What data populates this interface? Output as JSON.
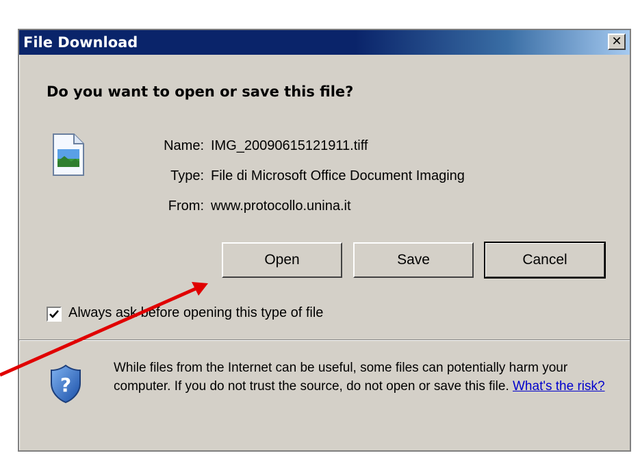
{
  "dialog": {
    "title": "File Download",
    "close_glyph": "✕",
    "question": "Do you want to open or save this file?",
    "file": {
      "icon": "image-file-icon",
      "name_label": "Name:",
      "name_value": "IMG_20090615121911.tiff",
      "type_label": "Type:",
      "type_value": "File di Microsoft Office Document Imaging",
      "from_label": "From:",
      "from_value": "www.protocollo.unina.it"
    },
    "buttons": {
      "open": "Open",
      "save": "Save",
      "cancel": "Cancel"
    },
    "always_ask": {
      "checked": true,
      "label": "Always ask before opening this type of file"
    },
    "warning": {
      "icon": "shield-question-icon",
      "text": "While files from the Internet can be useful, some files can potentially harm your computer. If you do not trust the source, do not open or save this file.",
      "link": "What's the risk?"
    }
  },
  "annotation": {
    "arrow_color": "#e00000"
  },
  "colors": {
    "dialog_bg": "#d4d0c8",
    "titlebar": "#0a246a",
    "link": "#0000cc"
  }
}
